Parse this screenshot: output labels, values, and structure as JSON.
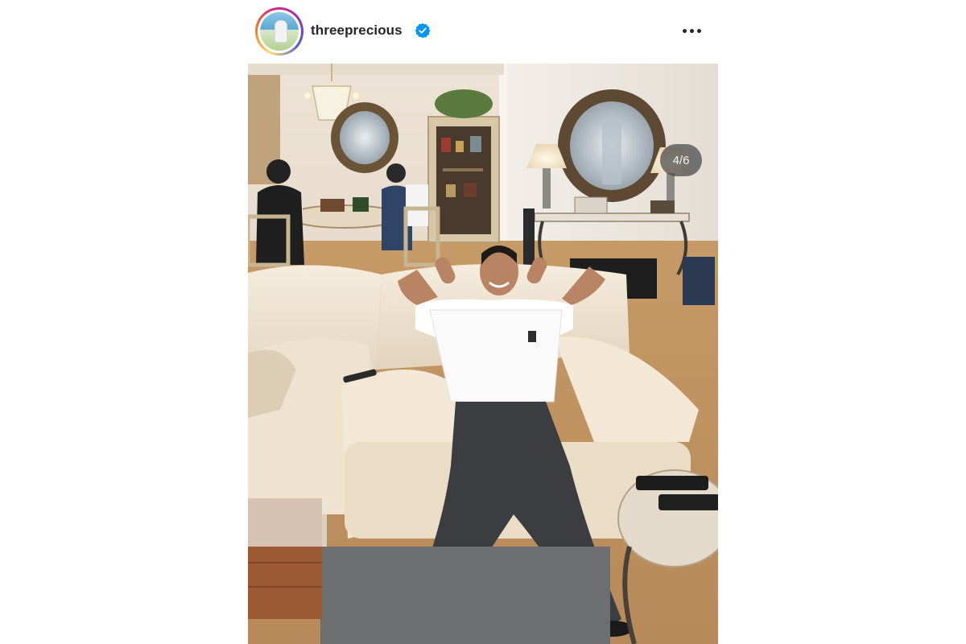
{
  "post": {
    "username": "threeprecious",
    "verified": true,
    "more_icon": "more-horizontal-icon",
    "carousel": {
      "current": 4,
      "total": 6,
      "label": "4/6"
    },
    "photo": {
      "kind": "photograph"
    }
  },
  "colors": {
    "username_text": "#262626",
    "verified_badge": "#0095f6",
    "story_ring_start": "#feda75",
    "story_ring_end": "#962fbf"
  }
}
